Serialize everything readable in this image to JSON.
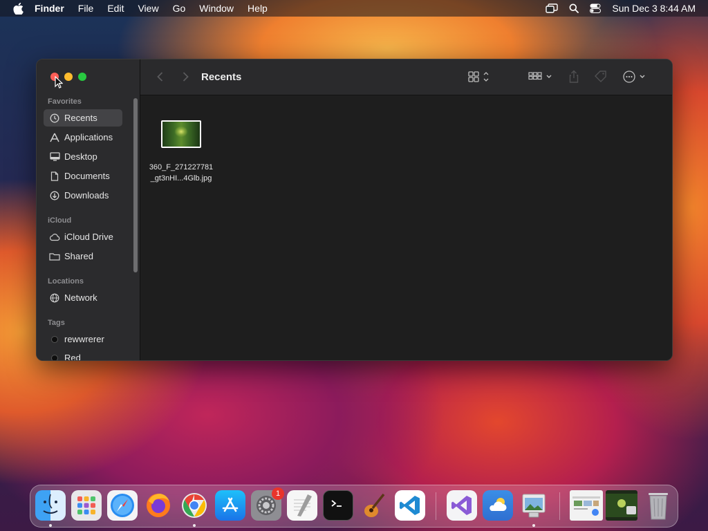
{
  "menubar": {
    "app_name": "Finder",
    "menus": [
      "File",
      "Edit",
      "View",
      "Go",
      "Window",
      "Help"
    ],
    "clock": "Sun Dec 3  8:44 AM"
  },
  "window": {
    "title": "Recents",
    "sidebar": {
      "sections": {
        "favorites": "Favorites",
        "icloud": "iCloud",
        "locations": "Locations",
        "tags": "Tags"
      },
      "favorites": [
        {
          "label": "Recents",
          "icon": "clock-icon",
          "selected": true
        },
        {
          "label": "Applications",
          "icon": "applications-icon"
        },
        {
          "label": "Desktop",
          "icon": "desktop-icon"
        },
        {
          "label": "Documents",
          "icon": "document-icon"
        },
        {
          "label": "Downloads",
          "icon": "download-icon"
        }
      ],
      "icloud": [
        {
          "label": "iCloud Drive",
          "icon": "cloud-icon"
        },
        {
          "label": "Shared",
          "icon": "shared-folder-icon"
        }
      ],
      "locations": [
        {
          "label": "Network",
          "icon": "globe-icon"
        }
      ],
      "tags": [
        {
          "label": "rewwrerer",
          "color": "#111111"
        },
        {
          "label": "Red",
          "color": "#111111"
        }
      ]
    },
    "files": [
      {
        "name_line1": "360_F_271227781",
        "name_line2": "_gt3nHI...4Glb.jpg"
      }
    ]
  },
  "dock": {
    "apps": [
      "Finder",
      "Launchpad",
      "Safari",
      "Firefox",
      "Google Chrome",
      "App Store",
      "System Settings",
      "TextEdit",
      "Terminal",
      "GarageBand",
      "Visual Studio Code",
      "Visual Studio",
      "Weather",
      "Preview"
    ],
    "settings_badge": "1"
  },
  "colors": {
    "window_bg": "#1e1e1e",
    "sidebar_bg": "#2b2b2d",
    "selected": "#434346",
    "close": "#ff5f57",
    "minimize": "#febc2e",
    "maximize": "#28c840"
  }
}
